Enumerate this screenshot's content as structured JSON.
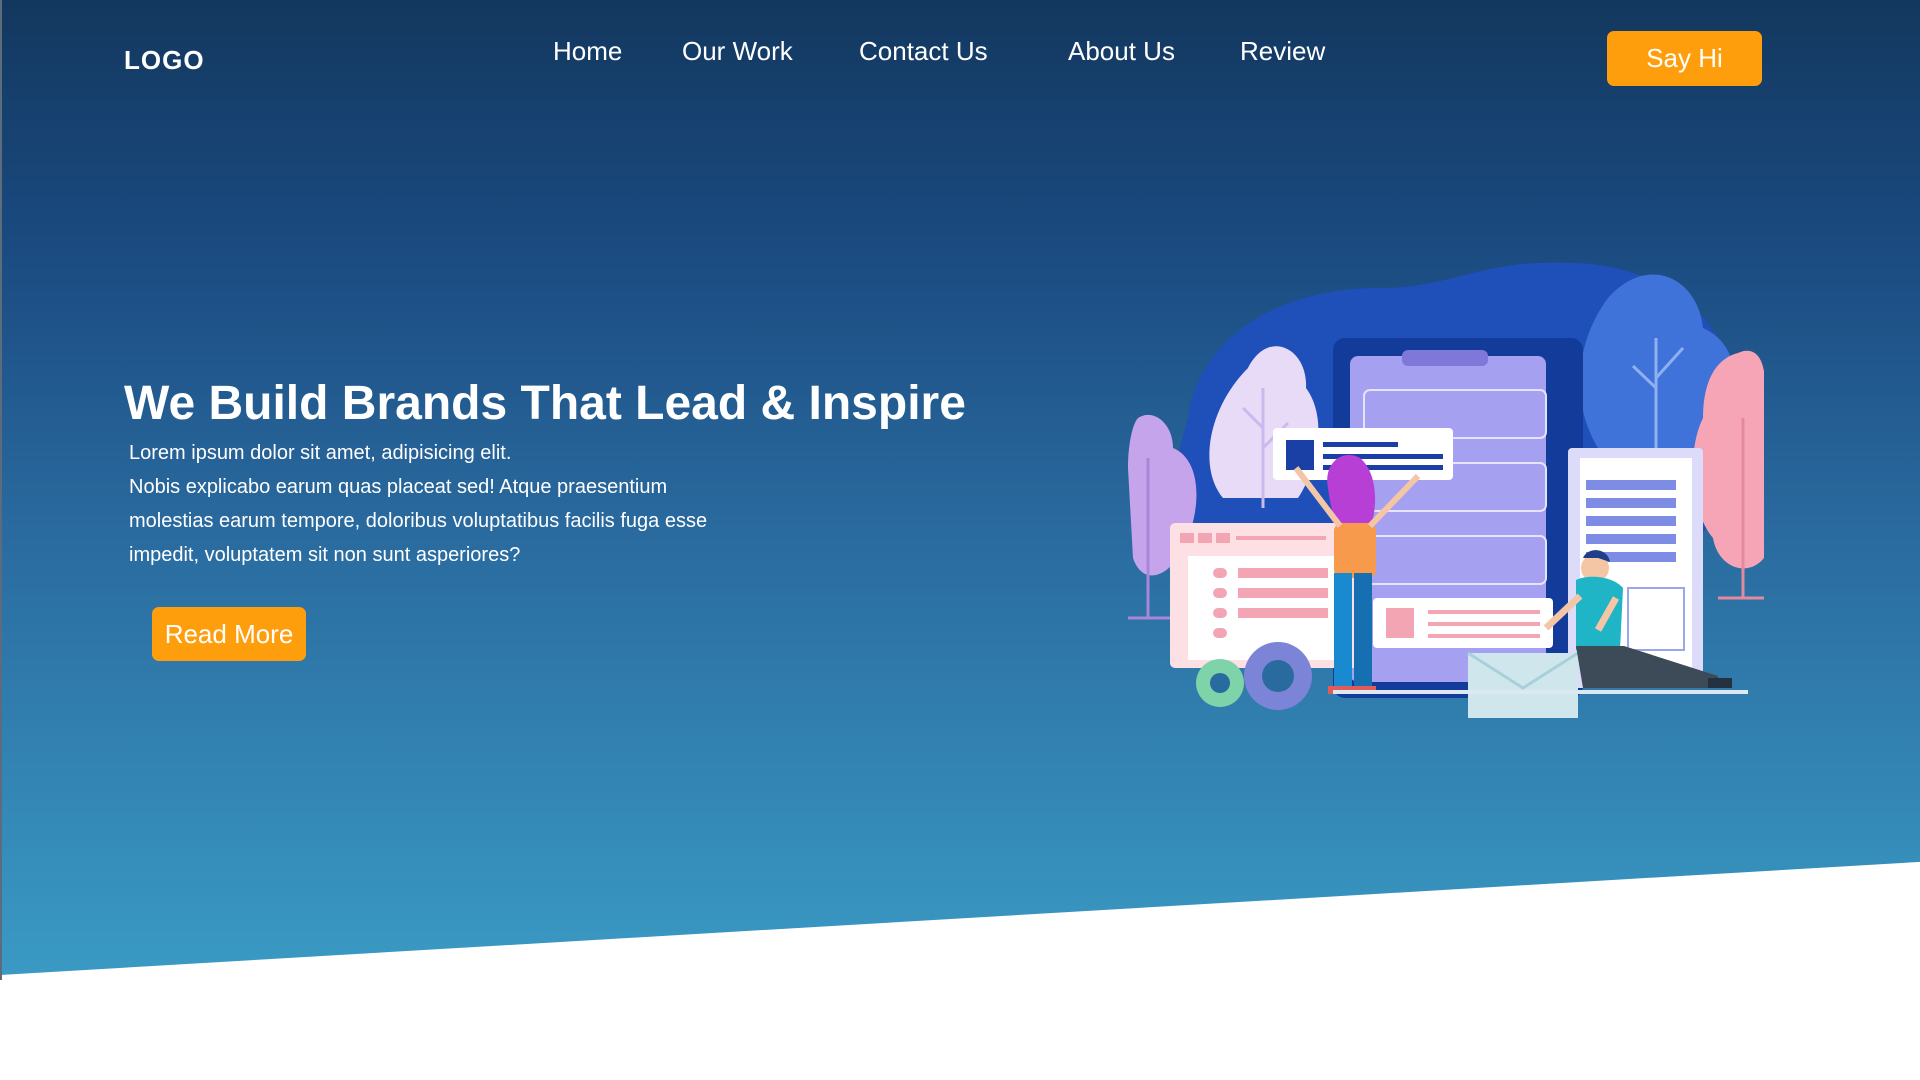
{
  "header": {
    "logo": "LOGO",
    "nav": [
      "Home",
      "Our Work",
      "Contact Us",
      "About Us",
      "Review"
    ],
    "cta_label": "Say Hi"
  },
  "hero": {
    "headline": "We Build Brands That Lead & Inspire",
    "body_lines": [
      "Lorem ipsum dolor sit amet, adipisicing elit.",
      "Nobis explicabo earum quas placeat sed! Atque praesentium",
      "molestias earum tempore, doloribus voluptatibus facilis fuga esse",
      "impedit, voluptatem sit non sunt asperiores?"
    ],
    "button_label": "Read More"
  },
  "illustration": {
    "icon": "team-building-app-illustration"
  },
  "colors": {
    "accent": "#ff9e0d",
    "hero_top": "#13385f",
    "hero_bottom": "#3a9ac4"
  }
}
